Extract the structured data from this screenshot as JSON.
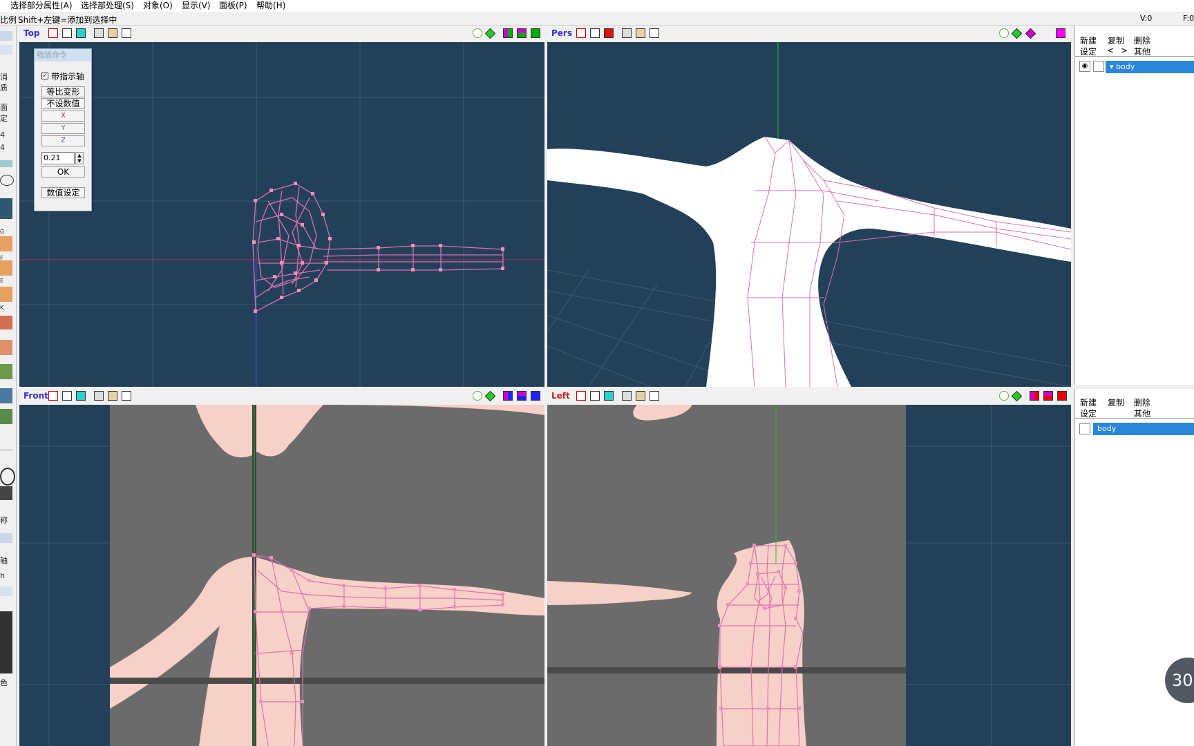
{
  "menu": {
    "items": [
      "选择部分属性(A)",
      "选择部处理(S)",
      "对象(O)",
      "显示(V)",
      "面板(P)",
      "帮助(H)"
    ]
  },
  "status": {
    "left_fragment": "比例",
    "hint": "Shift+左键=添加到选择中",
    "vertex_count": "V:0",
    "face_count": "F:0"
  },
  "left_toolbar": {
    "labels": [
      "消",
      "质",
      "面",
      "定",
      "4",
      "4",
      "G",
      "F",
      "E",
      "K",
      "称",
      "轴",
      "h",
      "色"
    ]
  },
  "viewports": [
    {
      "name": "Top",
      "title_color": "#3333cc"
    },
    {
      "name": "Pers",
      "title_color": "#3333cc"
    },
    {
      "name": "Front",
      "title_color": "#3333cc"
    },
    {
      "name": "Left",
      "title_color": "#d02020"
    }
  ],
  "scale_dialog": {
    "title": "缩放命令",
    "checkbox_label": "带指示轴",
    "checkbox_checked": true,
    "uniform_button": "等比变形",
    "no_value_button": "不设数值",
    "x_button": "X",
    "y_button": "Y",
    "z_button": "Z",
    "value": "0.21",
    "ok_button": "OK",
    "numeric_settings_button": "数值设定"
  },
  "object_panel": {
    "new_button": "新建",
    "copy_button": "复制",
    "delete_button": "删除",
    "settings_button": "设定",
    "prev_button": "<",
    "next_button": ">",
    "other_button": "其他",
    "object_name": "body"
  },
  "material_panel": {
    "new_button": "新建",
    "copy_button": "复制",
    "delete_button": "删除",
    "settings_button": "设定",
    "other_button": "其他",
    "material_name": "body"
  },
  "overlay": {
    "fps_value": "30"
  },
  "colors": {
    "viewport_bg": "#22405a",
    "wire_pink": "#e070b0",
    "skin": "#f7d0c8",
    "selection_blue": "#2a86d8"
  }
}
